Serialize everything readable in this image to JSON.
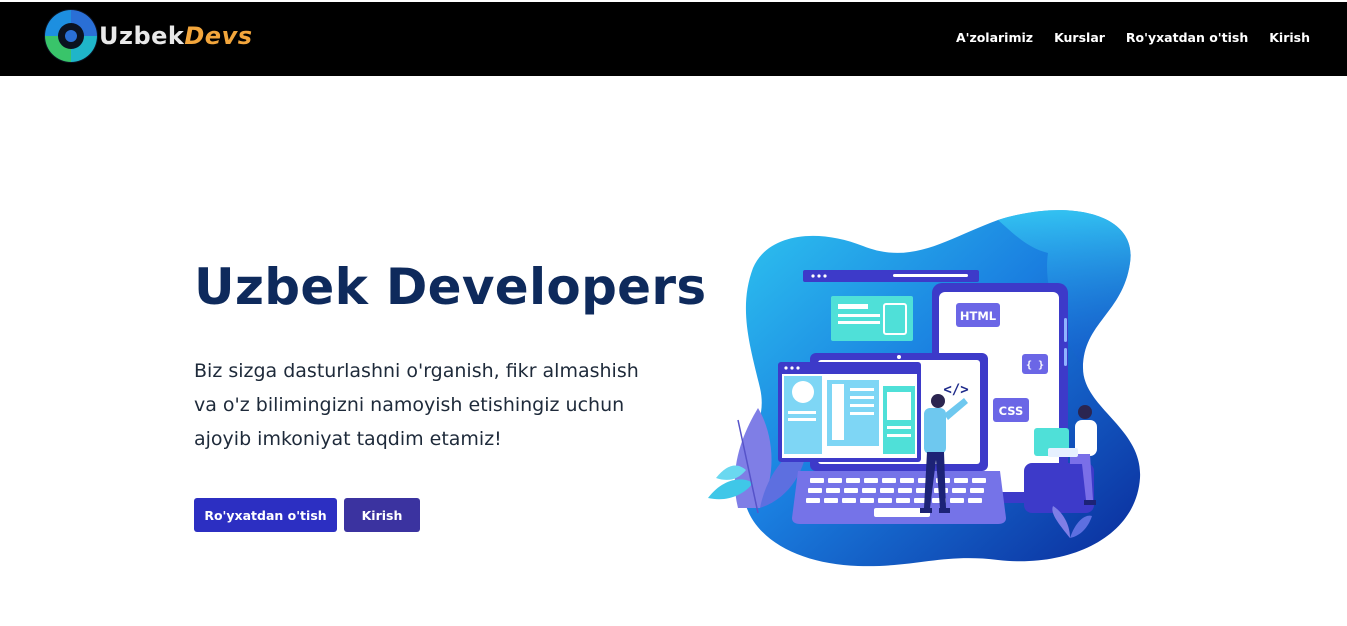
{
  "header": {
    "logo": {
      "word1": "Uzbek",
      "word2": "Devs"
    },
    "nav": [
      {
        "label": "A'zolarimiz"
      },
      {
        "label": "Kurslar"
      },
      {
        "label": "Ro'yxatdan o'tish"
      },
      {
        "label": "Kirish"
      }
    ]
  },
  "hero": {
    "title": "Uzbek Developers",
    "description": "Biz sizga dasturlashni o'rganish, fikr almashish va o'z bilimingizni namoyish etishingiz uchun ajoyib imkoniyat taqdim etamiz!",
    "buttons": {
      "register": "Ro'yxatdan o'tish",
      "login": "Kirish"
    }
  },
  "illustration": {
    "html_tag": "HTML",
    "braces_tag": "{ }",
    "css_tag": "CSS",
    "code_tag": "</>"
  },
  "colors": {
    "navbar": "#000000",
    "title": "#0e2a5c",
    "button_register": "#2c2fc2",
    "button_login": "#3b33a0",
    "logo_accent": "#f3a63c"
  }
}
